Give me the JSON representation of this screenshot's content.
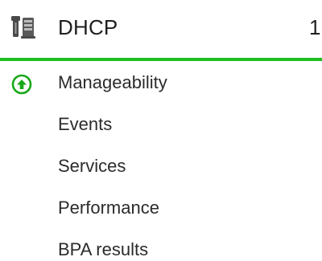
{
  "tile": {
    "title": "DHCP",
    "count": "1",
    "role_icon": "server-role-icon",
    "status_color": "#1fbd1f"
  },
  "items": [
    {
      "label": "Manageability",
      "icon": "status-up-icon"
    },
    {
      "label": "Events"
    },
    {
      "label": "Services"
    },
    {
      "label": "Performance"
    },
    {
      "label": "BPA results"
    }
  ]
}
